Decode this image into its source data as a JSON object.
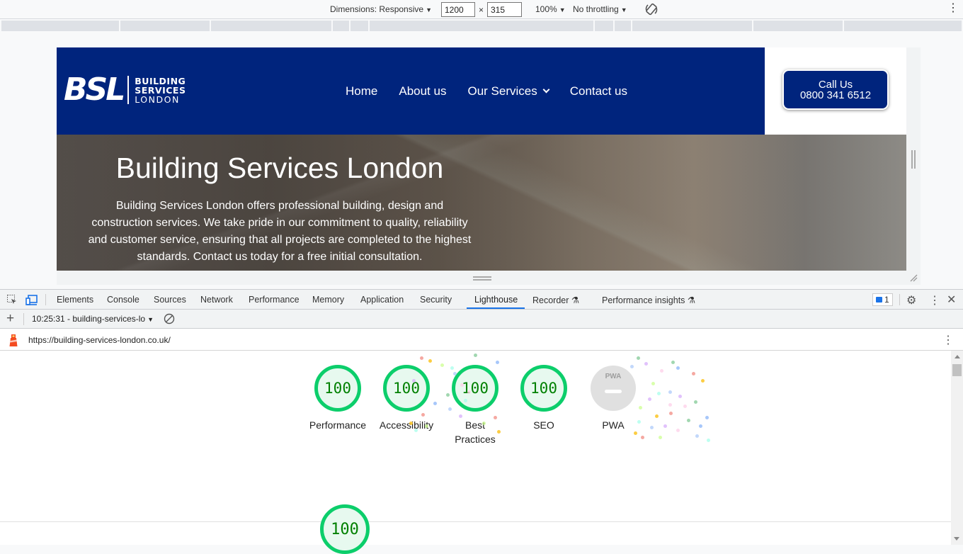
{
  "device_toolbar": {
    "dimensions_label": "Dimensions: Responsive",
    "width_value": "1200",
    "times": "×",
    "height_value": "315",
    "zoom": "100%",
    "throttling": "No throttling",
    "rotate_icon": "rotate-icon"
  },
  "site": {
    "logo": {
      "mark": "BSL",
      "line1": "BUILDING",
      "line2": "SERVICES",
      "line3": "LONDON"
    },
    "nav": [
      {
        "label": "Home"
      },
      {
        "label": "About us"
      },
      {
        "label": "Our Services",
        "has_dropdown": true
      },
      {
        "label": "Contact us"
      }
    ],
    "cta": {
      "line1": "Call Us",
      "line2": "0800 341 6512"
    },
    "hero": {
      "title": "Building Services London",
      "text": "Building Services London offers professional building, design and construction services. We take pride in our commitment to quality, reliability and customer service, ensuring that all projects are completed to the highest standards. Contact us today for a free initial consultation."
    },
    "colors": {
      "brand_blue": "#00247d"
    }
  },
  "devtools": {
    "tabs": [
      {
        "label": "Elements"
      },
      {
        "label": "Console"
      },
      {
        "label": "Sources"
      },
      {
        "label": "Network"
      },
      {
        "label": "Performance"
      },
      {
        "label": "Memory"
      },
      {
        "label": "Application"
      },
      {
        "label": "Security"
      },
      {
        "label": "Lighthouse",
        "active": true
      },
      {
        "label": "Recorder",
        "experimental": true
      },
      {
        "label": "Performance insights",
        "experimental": true
      }
    ],
    "issues_count": "1",
    "report_selector": "10:25:31 - building-services-lo",
    "url": "https://building-services-london.co.uk/",
    "scores": [
      {
        "label": "Performance",
        "value": "100"
      },
      {
        "label": "Accessibility",
        "value": "100"
      },
      {
        "label": "Best Practices",
        "label_line1": "Best",
        "label_line2": "Practices",
        "value": "100"
      },
      {
        "label": "SEO",
        "value": "100"
      },
      {
        "label": "PWA",
        "value": "—",
        "badge": "PWA"
      }
    ],
    "big_score": {
      "value": "100"
    },
    "colors": {
      "pass": "#0cce6b",
      "pass_text": "#008000",
      "accent": "#1a73e8"
    }
  }
}
